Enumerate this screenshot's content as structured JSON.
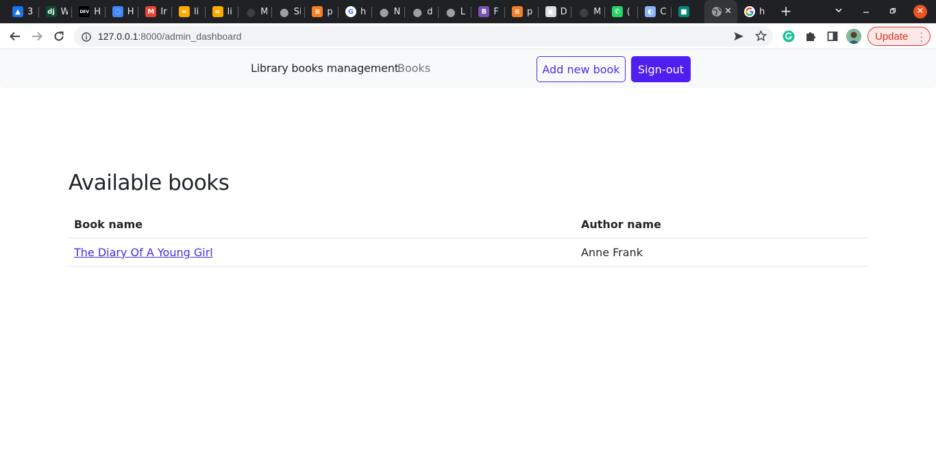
{
  "browser": {
    "tabs": [
      {
        "label": "3",
        "icon": "mountain-icon",
        "color": "#1a73e8"
      },
      {
        "label": "W",
        "icon": "django-icon",
        "color": "#0c4b33"
      },
      {
        "label": "H",
        "icon": "dev-icon",
        "color": "#000000"
      },
      {
        "label": "H",
        "icon": "ring-icon",
        "color": "#4285f4"
      },
      {
        "label": "Ir",
        "icon": "gmail-icon",
        "color": "#ea4335"
      },
      {
        "label": "li",
        "icon": "infinity-icon",
        "color": "#f9ab00"
      },
      {
        "label": "li",
        "icon": "infinity-icon",
        "color": "#f9ab00"
      },
      {
        "label": "M",
        "icon": "github-icon",
        "color": "#3c4043"
      },
      {
        "label": "Si",
        "icon": "globe-icon",
        "color": "#9aa0a6"
      },
      {
        "label": "p",
        "icon": "stackoverflow-icon",
        "color": "#f48024"
      },
      {
        "label": "h",
        "icon": "google-icon",
        "color": "#ffffff"
      },
      {
        "label": "N",
        "icon": "globe-icon",
        "color": "#9aa0a6"
      },
      {
        "label": "d",
        "icon": "globe-icon",
        "color": "#9aa0a6"
      },
      {
        "label": "L",
        "icon": "globe-icon",
        "color": "#9aa0a6"
      },
      {
        "label": "F",
        "icon": "bootstrap-icon",
        "color": "#7952b3"
      },
      {
        "label": "p",
        "icon": "stackoverflow-icon",
        "color": "#f48024"
      },
      {
        "label": "D",
        "icon": "film-icon",
        "color": "#dadce0"
      },
      {
        "label": "M",
        "icon": "github-icon",
        "color": "#3c4043"
      },
      {
        "label": "(",
        "icon": "whatsapp-icon",
        "color": "#25d366"
      },
      {
        "label": "C",
        "icon": "moon-icon",
        "color": "#8ab4f8"
      },
      {
        "label": "",
        "icon": "meet-icon",
        "color": "#00897b"
      }
    ],
    "active_tab_icon": "globe-icon",
    "last_tab": {
      "label": "h",
      "icon": "google-icon"
    },
    "url_host": "127.0.0.1",
    "url_rest": ":8000/admin_dashboard",
    "update_label": "Update"
  },
  "navbar": {
    "brand": "Library books management",
    "books_link": "Books",
    "add_book_label": "Add new book",
    "signout_label": "Sign-out",
    "accent": "#4f1ef0"
  },
  "main": {
    "title": "Available books",
    "columns": [
      "Book name",
      "Author name"
    ],
    "rows": [
      {
        "book": "The Diary Of A Young Girl",
        "author": "Anne Frank"
      }
    ]
  }
}
